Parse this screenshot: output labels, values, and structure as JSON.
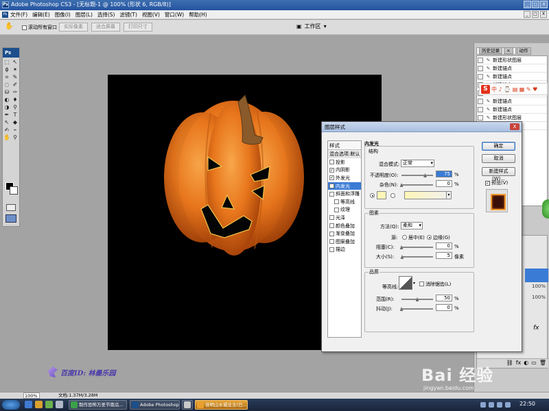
{
  "titlebar": {
    "app_badge": "Ps",
    "title": "Adobe Photoshop CS3 - [无标题-1 @ 100% (形状 6, RGB/8)]",
    "buttons": [
      "_",
      "□",
      "X"
    ]
  },
  "menubar": {
    "app_icon": "Ps",
    "items": [
      "文件(F)",
      "编辑(E)",
      "图像(I)",
      "图层(L)",
      "选择(S)",
      "滤镜(T)",
      "视图(V)",
      "窗口(W)",
      "帮助(H)"
    ],
    "mdi_buttons": [
      "_",
      "□",
      "X"
    ]
  },
  "optionsbar": {
    "scroll_all_label": "滚动所有窗口",
    "actual_pixels": "实际像素",
    "fit_screen": "适合屏幕",
    "print_size": "打印尺寸",
    "workspace": "工作区"
  },
  "toolbox": {
    "logo": "Ps",
    "tool_glyphs": [
      "⬚",
      "↖",
      "ϕ",
      "✶",
      "⌗",
      "✎",
      "◌",
      "✐",
      "⛁",
      "✑",
      "◐",
      "♦",
      "◑",
      "⚲",
      "✒",
      "T",
      "↖",
      "◆",
      "✍",
      "⌁",
      "✋",
      "⚲"
    ],
    "fg_color": "#000000",
    "bg_color": "#ffffff"
  },
  "history": {
    "tabs": [
      "历史记录",
      "动作"
    ],
    "tab_close": "×",
    "items": [
      {
        "label": "新建形状图层"
      },
      {
        "label": "新建锚点"
      },
      {
        "label": "新建锚点"
      },
      {
        "label": "新建锚点"
      },
      {
        "label": "新建形状图层"
      },
      {
        "label": "新建锚点"
      },
      {
        "label": "新建锚点"
      },
      {
        "label": "新建形状图层"
      },
      {
        "label": "新建锚点"
      }
    ]
  },
  "ime_bar": {
    "logo": "S",
    "label": "中 ♪ ⌚ ▤ ▦ ✎ ♥"
  },
  "layers": {
    "values": [
      "100%",
      "100%"
    ],
    "fx_label": "fx",
    "footer_icons": [
      "⛓",
      "fx",
      "◐",
      "▭",
      "🗑"
    ]
  },
  "dialog": {
    "title": "图层样式",
    "close": "X",
    "styles_header": "样式",
    "blend_options": "混合选项:默认",
    "style_items": [
      {
        "label": "投影",
        "checked": false,
        "selected": false,
        "indent": false
      },
      {
        "label": "内阴影",
        "checked": true,
        "selected": false,
        "indent": false
      },
      {
        "label": "外发光",
        "checked": true,
        "selected": false,
        "indent": false
      },
      {
        "label": "内发光",
        "checked": true,
        "selected": true,
        "indent": false
      },
      {
        "label": "斜面和浮雕",
        "checked": false,
        "selected": false,
        "indent": false
      },
      {
        "label": "等高线",
        "checked": false,
        "selected": false,
        "indent": true
      },
      {
        "label": "纹理",
        "checked": false,
        "selected": false,
        "indent": true
      },
      {
        "label": "光泽",
        "checked": false,
        "selected": false,
        "indent": false
      },
      {
        "label": "颜色叠加",
        "checked": false,
        "selected": false,
        "indent": false
      },
      {
        "label": "渐变叠加",
        "checked": false,
        "selected": false,
        "indent": false
      },
      {
        "label": "图案叠加",
        "checked": false,
        "selected": false,
        "indent": false
      },
      {
        "label": "描边",
        "checked": false,
        "selected": false,
        "indent": false
      }
    ],
    "inner_glow": {
      "section_title": "内发光",
      "structure": {
        "title": "结构",
        "blend_mode_label": "混合模式:",
        "blend_mode_value": "正常",
        "opacity_label": "不透明度(O):",
        "opacity_value": "75",
        "opacity": 75,
        "noise_label": "杂色(N):",
        "noise_value": "0",
        "noise": 0,
        "percent": "%",
        "glow_color": "#fff6b8"
      },
      "elements": {
        "title": "图素",
        "method_label": "方法(Q):",
        "method_value": "柔和",
        "source_label": "源:",
        "center_label": "居中(E)",
        "edge_label": "边缘(G)",
        "choke_label": "阻塞(C):",
        "choke_value": "0",
        "choke": 0,
        "size_label": "大小(S):",
        "size_value": "5",
        "size": 5,
        "percent": "%",
        "px": "像素"
      },
      "quality": {
        "title": "品质",
        "contour_label": "等高线:",
        "antialias_label": "消除锯齿(L)",
        "range_label": "范围(R):",
        "range_value": "50",
        "range": 50,
        "jitter_label": "抖动(J):",
        "jitter_value": "0",
        "jitter": 0,
        "percent": "%"
      }
    },
    "buttons": {
      "ok": "确定",
      "cancel": "取消",
      "new_style": "新建样式(W)...",
      "preview": "预览(V)"
    }
  },
  "watermark": {
    "author": "百度ID: 林墨乐园",
    "brand": "Bai 经验",
    "url": "jingyan.baidu.com"
  },
  "statusbar": {
    "zoom": "100%",
    "doc": "文档:1.37M/3.28M"
  },
  "taskbar": {
    "tasks": [
      {
        "label": "制作恐怖万圣节南瓜...",
        "active": false
      },
      {
        "label": "Adobe Photoshop ...",
        "active": false
      },
      {
        "label": "",
        "active": false
      },
      {
        "label": "佳明山水城业主(已...",
        "active": false
      }
    ],
    "clock": "22:50"
  },
  "colors": {
    "pumpkin": "#e8761c",
    "stem": "#8a5a2a",
    "glow": "#f2c24a",
    "selection": "#3a7bd5"
  }
}
